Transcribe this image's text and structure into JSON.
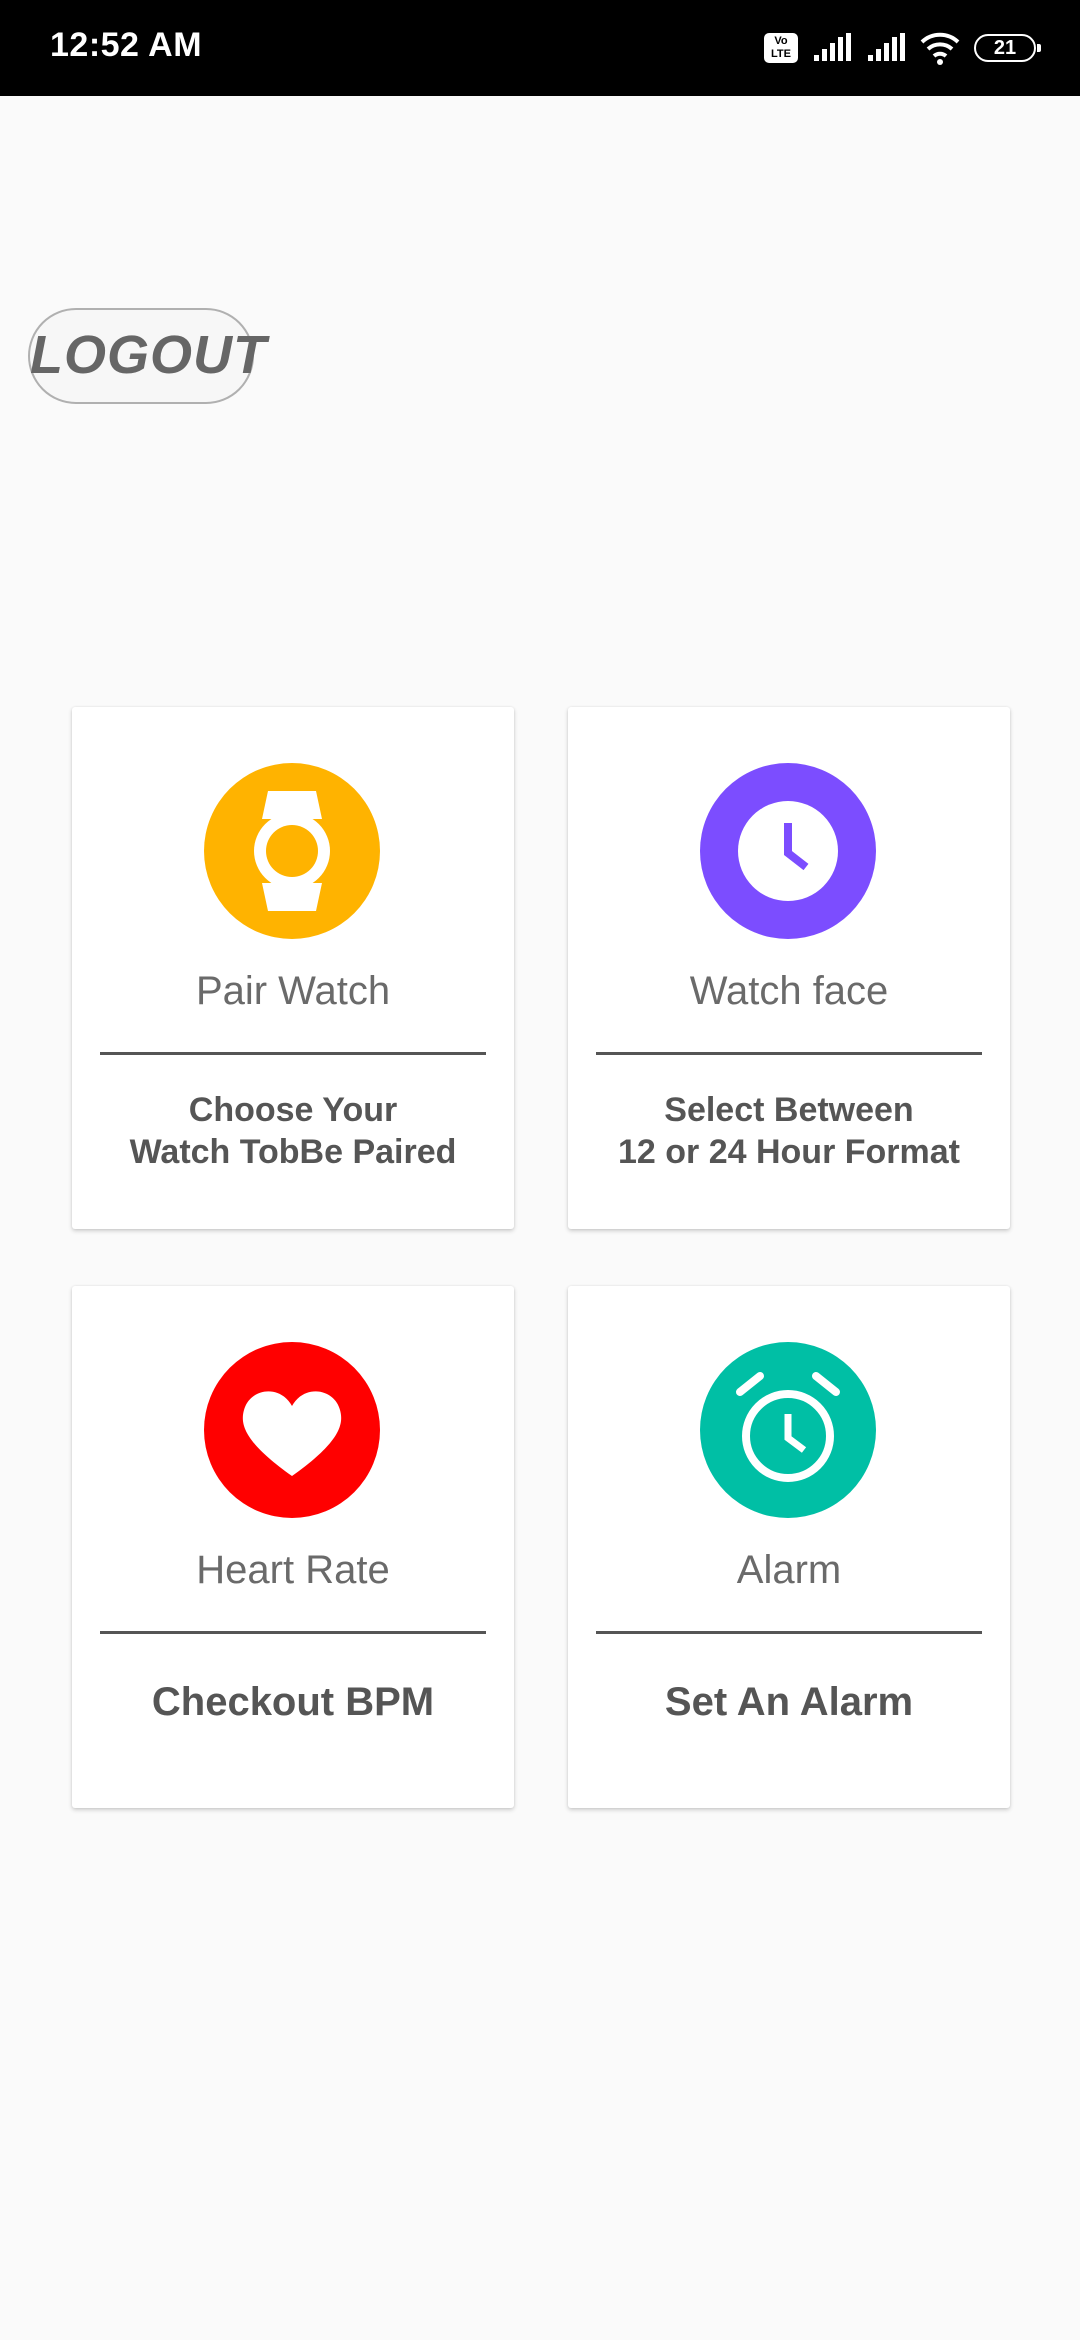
{
  "status_bar": {
    "time": "12:52 AM",
    "volte": "Vo LTE",
    "battery": "21"
  },
  "logout_label": "LOGOUT",
  "cards": [
    {
      "title": "Pair Watch",
      "desc_line1": "Choose Your",
      "desc_line2": "Watch TobBe Paired",
      "icon": "watch-icon",
      "color": "#FFB300"
    },
    {
      "title": "Watch face",
      "desc_line1": "Select Between",
      "desc_line2": "12 or 24 Hour Format",
      "icon": "clock-icon",
      "color": "#7C4DFF"
    },
    {
      "title": "Heart Rate",
      "desc_line1": "Checkout BPM",
      "icon": "heart-icon",
      "color": "#FF0000"
    },
    {
      "title": "Alarm",
      "desc_line1": "Set An Alarm",
      "icon": "alarm-clock-icon",
      "color": "#00BFA5"
    }
  ]
}
